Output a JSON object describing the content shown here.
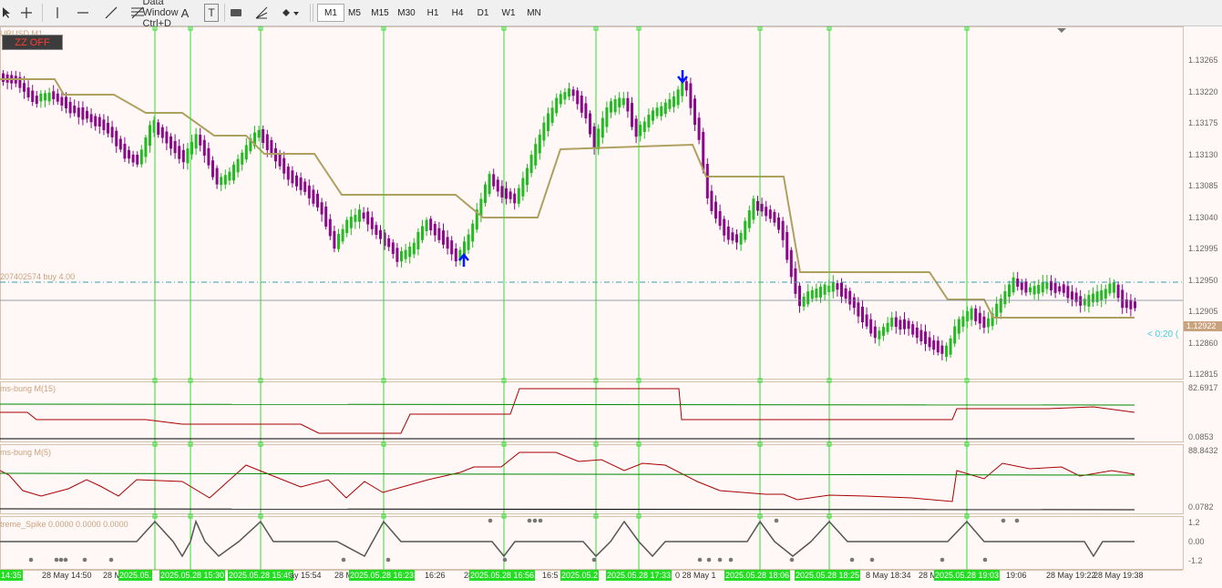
{
  "toolbar": {
    "timeframes": [
      "M1",
      "M5",
      "M15",
      "M30",
      "H1",
      "H4",
      "D1",
      "W1",
      "MN"
    ],
    "active_timeframe": "M1",
    "data_window_hint": "Data Window  Ctrl+D",
    "text_tool_label": "A",
    "text_label_tool_label": "T"
  },
  "chart": {
    "symbol_label": "URUSD,M1",
    "zz_button_label": "ZZ OFF",
    "order_label": "207402574 buy 4.00",
    "current_price": "1.12922",
    "bar_timer": "< 0:20 (",
    "price_labels": [
      "1.13265",
      "1.13220",
      "1.13175",
      "1.13130",
      "1.13085",
      "1.13040",
      "1.12995",
      "1.12950",
      "1.12905",
      "1.12860",
      "1.12815"
    ],
    "colors": {
      "bull": "#22bb22",
      "bear": "#8b0a8b",
      "vline": "#33dd33",
      "ma": "#b0a060",
      "order": "#3aa0b0"
    }
  },
  "indicators": [
    {
      "label": "ms-bung M(15)",
      "max": "82.6917",
      "min": "0.0853"
    },
    {
      "label": "ms-bung M(5)",
      "max": "88.8432",
      "min": "0.0782"
    },
    {
      "label": "treme_Spike 0.0000 0.0000 0.0000",
      "max": "1.2",
      "mid": "0.00",
      "min": "-1.2"
    }
  ],
  "time_axis": [
    {
      "text": "14:35",
      "hl": true
    },
    {
      "text": "28 May 14:50",
      "hl": false
    },
    {
      "text": "28 M",
      "hl": false
    },
    {
      "text": "2025.05.",
      "hl": true
    },
    {
      "text": "2025.05.28 15:30",
      "hl": true
    },
    {
      "text": "2025.05.28 15:49",
      "hl": true
    },
    {
      "text": "ay 15:54",
      "hl": false
    },
    {
      "text": "28 M",
      "hl": false
    },
    {
      "text": "2025.05.28 16:23",
      "hl": true
    },
    {
      "text": "16:26",
      "hl": false
    },
    {
      "text": "28 M",
      "hl": false
    },
    {
      "text": "2025.05.28 16:56",
      "hl": true
    },
    {
      "text": "16:5",
      "hl": false
    },
    {
      "text": "2025.05.2",
      "hl": true
    },
    {
      "text": "2025.05.28 17:33",
      "hl": true
    },
    {
      "text": "0  28 May 1",
      "hl": false
    },
    {
      "text": "2025.05.28 18:06",
      "hl": true
    },
    {
      "text": "2025.05.28 18:25",
      "hl": true
    },
    {
      "text": "8 May 18:34",
      "hl": false
    },
    {
      "text": "28 M",
      "hl": false
    },
    {
      "text": "2025.05.28 19:03",
      "hl": true
    },
    {
      "text": "19:06",
      "hl": false
    },
    {
      "text": "28 May 19:22",
      "hl": false
    },
    {
      "text": "28 May 19:38",
      "hl": false
    }
  ]
}
